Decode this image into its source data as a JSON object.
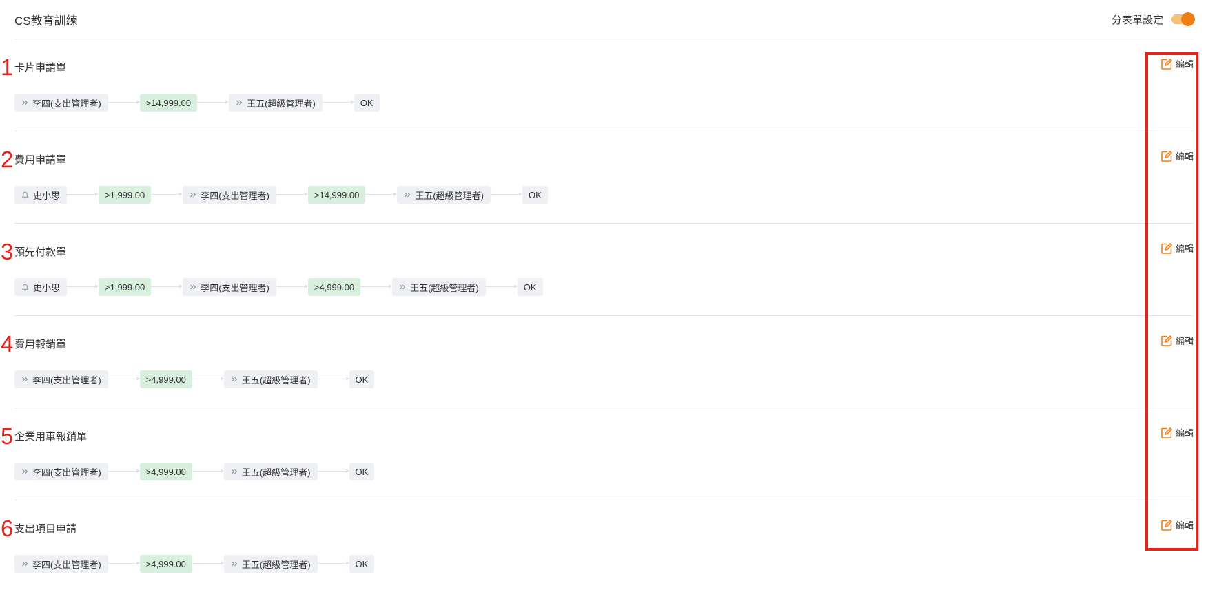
{
  "header": {
    "title": "CS教育訓練",
    "toggle_label": "分表單設定",
    "toggle_on": true
  },
  "colors": {
    "accent": "#f07e17",
    "annotation": "#e8231b",
    "amount_bg": "#d7efdc",
    "chip_bg": "#eef0f4"
  },
  "edit_label": "編輯",
  "sections": [
    {
      "number": "1",
      "title": "卡片申請單",
      "flow": [
        {
          "type": "approver",
          "icon": "double-chevron",
          "label": "李四(支出管理者)"
        },
        {
          "type": "amount",
          "label": ">14,999.00"
        },
        {
          "type": "approver",
          "icon": "double-chevron",
          "label": "王五(超級管理者)"
        },
        {
          "type": "ok",
          "label": "OK"
        }
      ]
    },
    {
      "number": "2",
      "title": "費用申請單",
      "flow": [
        {
          "type": "approver",
          "icon": "bell",
          "label": "史小思"
        },
        {
          "type": "amount",
          "label": ">1,999.00"
        },
        {
          "type": "approver",
          "icon": "double-chevron",
          "label": "李四(支出管理者)"
        },
        {
          "type": "amount",
          "label": ">14,999.00"
        },
        {
          "type": "approver",
          "icon": "double-chevron",
          "label": "王五(超級管理者)"
        },
        {
          "type": "ok",
          "label": "OK"
        }
      ]
    },
    {
      "number": "3",
      "title": "預先付款單",
      "flow": [
        {
          "type": "approver",
          "icon": "bell",
          "label": "史小思"
        },
        {
          "type": "amount",
          "label": ">1,999.00"
        },
        {
          "type": "approver",
          "icon": "double-chevron",
          "label": "李四(支出管理者)"
        },
        {
          "type": "amount",
          "label": ">4,999.00"
        },
        {
          "type": "approver",
          "icon": "double-chevron",
          "label": "王五(超級管理者)"
        },
        {
          "type": "ok",
          "label": "OK"
        }
      ]
    },
    {
      "number": "4",
      "title": "費用報銷單",
      "flow": [
        {
          "type": "approver",
          "icon": "double-chevron",
          "label": "李四(支出管理者)"
        },
        {
          "type": "amount",
          "label": ">4,999.00"
        },
        {
          "type": "approver",
          "icon": "double-chevron",
          "label": "王五(超級管理者)"
        },
        {
          "type": "ok",
          "label": "OK"
        }
      ]
    },
    {
      "number": "5",
      "title": "企業用車報銷單",
      "flow": [
        {
          "type": "approver",
          "icon": "double-chevron",
          "label": "李四(支出管理者)"
        },
        {
          "type": "amount",
          "label": ">4,999.00"
        },
        {
          "type": "approver",
          "icon": "double-chevron",
          "label": "王五(超級管理者)"
        },
        {
          "type": "ok",
          "label": "OK"
        }
      ]
    },
    {
      "number": "6",
      "title": "支出項目申請",
      "flow": [
        {
          "type": "approver",
          "icon": "double-chevron",
          "label": "李四(支出管理者)"
        },
        {
          "type": "amount",
          "label": ">4,999.00"
        },
        {
          "type": "approver",
          "icon": "double-chevron",
          "label": "王五(超級管理者)"
        },
        {
          "type": "ok",
          "label": "OK"
        }
      ]
    }
  ]
}
